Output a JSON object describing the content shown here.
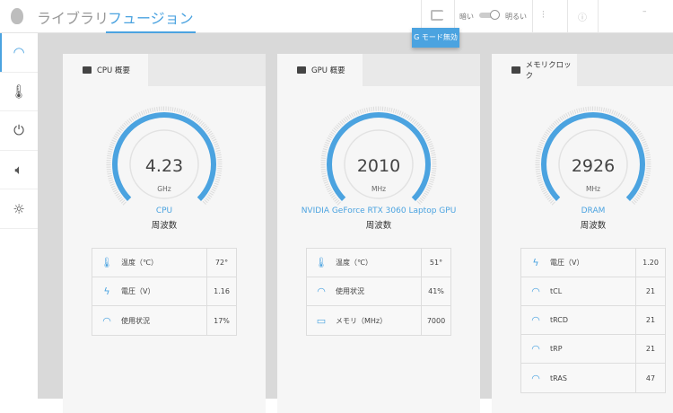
{
  "topbar": {
    "tabs": [
      {
        "label": "ライブラリ"
      },
      {
        "label": "フュージョン"
      }
    ],
    "brightness": {
      "dark": "暗い",
      "bright": "明るい"
    },
    "gmode_tooltip": "G モード無効"
  },
  "sidebar": {
    "items": [
      {
        "icon": "gauge-icon"
      },
      {
        "icon": "thermometer-icon"
      },
      {
        "icon": "power-plug-icon"
      },
      {
        "icon": "speaker-icon"
      },
      {
        "icon": "brightness-icon"
      }
    ]
  },
  "accent": "#4ba3e0",
  "cards": [
    {
      "title": "CPU 概要",
      "gauge": {
        "value": "4.23",
        "unit": "GHz",
        "label": "CPU",
        "sub": "周波数",
        "fill": 1.0
      },
      "rows": [
        {
          "icon": "thermometer-icon",
          "label": "温度（℃）",
          "value": "72°"
        },
        {
          "icon": "bolt-icon",
          "label": "電圧（V）",
          "value": "1.16"
        },
        {
          "icon": "usage-gauge-icon",
          "label": "使用状況",
          "value": "17%"
        }
      ]
    },
    {
      "title": "GPU 概要",
      "gauge": {
        "value": "2010",
        "unit": "MHz",
        "label": "NVIDIA GeForce RTX 3060 Laptop GPU",
        "sub": "周波数",
        "fill": 1.0
      },
      "rows": [
        {
          "icon": "thermometer-icon",
          "label": "温度（℃）",
          "value": "51°"
        },
        {
          "icon": "usage-gauge-icon",
          "label": "使用状況",
          "value": "41%"
        },
        {
          "icon": "memory-icon",
          "label": "メモリ（MHz）",
          "value": "7000"
        }
      ]
    },
    {
      "title": "メモリクロック",
      "gauge": {
        "value": "2926",
        "unit": "MHz",
        "label": "DRAM",
        "sub": "周波数",
        "fill": 1.0
      },
      "rows": [
        {
          "icon": "bolt-icon",
          "label": "電圧（V）",
          "value": "1.20"
        },
        {
          "icon": "usage-gauge-icon",
          "label": "tCL",
          "value": "21"
        },
        {
          "icon": "usage-gauge-icon",
          "label": "tRCD",
          "value": "21"
        },
        {
          "icon": "usage-gauge-icon",
          "label": "tRP",
          "value": "21"
        },
        {
          "icon": "usage-gauge-icon",
          "label": "tRAS",
          "value": "47"
        }
      ]
    }
  ]
}
